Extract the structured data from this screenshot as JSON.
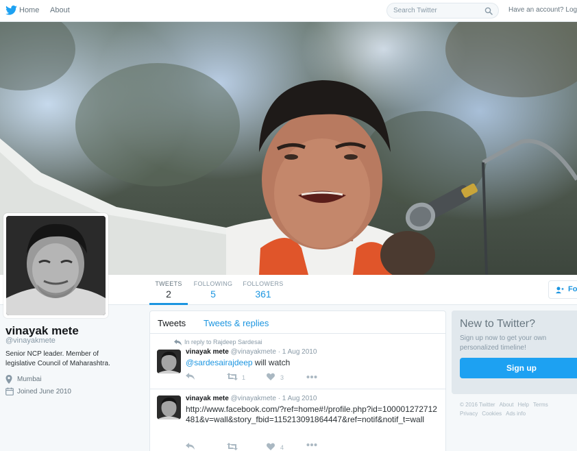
{
  "nav": {
    "home_label": "Home",
    "about_label": "About",
    "search_placeholder": "Search Twitter",
    "have_account_text": "Have an account?",
    "login_label": "Log in"
  },
  "profile": {
    "name": "vinayak mete",
    "handle": "@vinayakmete",
    "bio": "Senior NCP leader. Member of legislative Council of Maharashtra.",
    "location": "Mumbai",
    "joined": "Joined June 2010"
  },
  "stats": [
    {
      "label": "TWEETS",
      "value": "2"
    },
    {
      "label": "FOLLOWING",
      "value": "5"
    },
    {
      "label": "FOLLOWERS",
      "value": "361"
    }
  ],
  "follow_button_label": "Fo",
  "timeline": {
    "tabs": [
      {
        "label": "Tweets"
      },
      {
        "label": "Tweets & replies"
      }
    ],
    "tweets": [
      {
        "reply_context": "In reply to Rajdeep Sardesai",
        "name": "vinayak mete",
        "handle": "@vinayakmete",
        "date": "1 Aug 2010",
        "mention": "@sardesairajdeep",
        "text": "will watch",
        "retweets": "1",
        "likes": "3"
      },
      {
        "name": "vinayak mete",
        "handle": "@vinayakmete",
        "date": "1 Aug 2010",
        "text": "http://www.facebook.com/?ref=home#!/profile.php?id=100001272712481&v=wall&story_fbid=115213091864447&ref=notif&notif_t=wall",
        "retweets": "",
        "likes": "4"
      }
    ]
  },
  "sidebar": {
    "title": "New to Twitter?",
    "subtitle": "Sign up now to get your own personalized timeline!",
    "signup_label": "Sign up",
    "footer_links": [
      "© 2016 Twitter",
      "About",
      "Help",
      "Terms",
      "Privacy",
      "Cookies",
      "Ads info"
    ]
  },
  "colors": {
    "accent": "#1b95e0",
    "signup_button": "#1da1f2",
    "banner_shirt": "#e0552a"
  }
}
